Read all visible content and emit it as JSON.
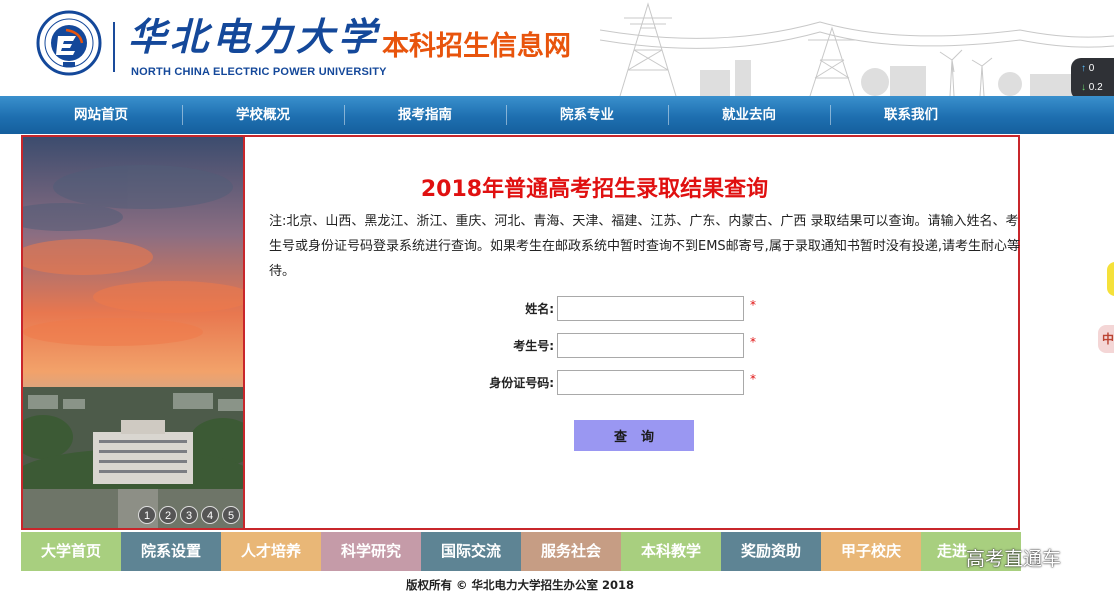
{
  "header": {
    "university_name_cn": "华北电力大学",
    "university_name_en": "NORTH CHINA ELECTRIC POWER UNIVERSITY",
    "site_title": "本科招生信息网",
    "logo_icon": "university-seal-icon"
  },
  "widget": {
    "up_value": "0",
    "down_value": "0.2",
    "up_icon": "arrow-up-icon",
    "down_icon": "arrow-down-icon"
  },
  "nav": {
    "items": [
      "网站首页",
      "学校概况",
      "报考指南",
      "院系专业",
      "就业去向",
      "联系我们"
    ]
  },
  "slider": {
    "dots": [
      "1",
      "2",
      "3",
      "4",
      "5"
    ]
  },
  "query": {
    "title": "2018年普通高考招生录取结果查询",
    "notice": "注:北京、山西、黑龙江、浙江、重庆、河北、青海、天津、福建、江苏、广东、内蒙古、广西 录取结果可以查询。请输入姓名、考生号或身份证号码登录系统进行查询。如果考生在邮政系统中暂时查询不到EMS邮寄号,属于录取通知书暂时没有投递,请考生耐心等待。",
    "fields": {
      "name_label": "姓名:",
      "exam_label": "考生号:",
      "id_label": "身份证号码:",
      "name_value": "",
      "exam_value": "",
      "id_value": "",
      "required_mark": "*"
    },
    "button_label": "查询"
  },
  "bottom_nav": {
    "items": [
      {
        "label": "大学首页",
        "color": "#a8cf7f"
      },
      {
        "label": "院系设置",
        "color": "#5e8494"
      },
      {
        "label": "人才培养",
        "color": "#e9b777"
      },
      {
        "label": "科学研究",
        "color": "#c59ba8"
      },
      {
        "label": "国际交流",
        "color": "#5e8494"
      },
      {
        "label": "服务社会",
        "color": "#c69d84"
      },
      {
        "label": "本科教学",
        "color": "#a8cf7f"
      },
      {
        "label": "奖励资助",
        "color": "#5e8494"
      },
      {
        "label": "甲子校庆",
        "color": "#e9b777"
      },
      {
        "label": "走进",
        "color": "#a8cf7f"
      }
    ]
  },
  "footer": {
    "copyright": "版权所有 © 华北电力大学招生办公室 2018"
  },
  "watermark": "高考直通车",
  "side_tab_text": "中",
  "colors": {
    "nav_blue": "#1e6fb0",
    "title_red": "#e01010",
    "frame_red": "#c8262b",
    "button_purple": "#9a97f2",
    "brand_orange": "#e8540c",
    "brand_blue": "#14489a"
  }
}
